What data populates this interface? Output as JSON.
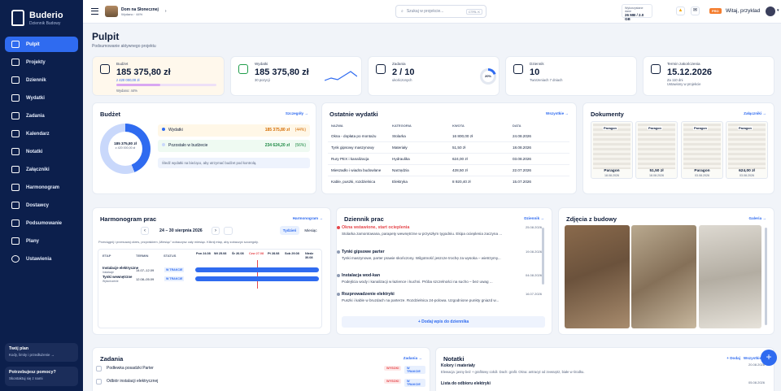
{
  "brand": {
    "title": "Buderio",
    "subtitle": "Dziennik Budowy"
  },
  "nav": [
    "Pulpit",
    "Projekty",
    "Dziennik",
    "Wydatki",
    "Zadania",
    "Kalendarz",
    "Notatki",
    "Załączniki",
    "Harmonogram",
    "Dostawcy",
    "Podsumowanie",
    "Plany",
    "Ustawienia"
  ],
  "plan": {
    "title": "Twój plan",
    "text": "Kody, limity i przedłużenie →"
  },
  "help": {
    "title": "Potrzebujesz pomocy?",
    "text": "Skontaktuj się z nami"
  },
  "topbar": {
    "project_name": "Dom na Słonecznej",
    "project_meta": "Wydano · 44%",
    "search_placeholder": "Szukaj w projekcie...",
    "kbd": "CTRL K",
    "storage_label": "Wykorzystane dane",
    "storage_value": "26 MB / 2.0 GB",
    "pro": "PRO",
    "welcome": "Witaj, przyklad"
  },
  "page": {
    "title": "Pulpit",
    "subtitle": "Podsumowanie aktywnego projektu"
  },
  "stats": [
    {
      "label": "Budżet",
      "value": "185 375,80 zł",
      "sub": "z 420 000,00 zł",
      "sub2": "Wydano: 44%"
    },
    {
      "label": "Wydatki",
      "value": "185 375,80 zł",
      "sub": "30 pozycji"
    },
    {
      "label": "Zadania",
      "value": "2 / 10",
      "sub": "ukończonych",
      "ring": "20%"
    },
    {
      "label": "Dziennik",
      "value": "10",
      "sub": "Tworzeniach 7 dniach"
    },
    {
      "label": "Termin zakończenia",
      "value": "15.12.2026",
      "sub": "Za 110 dni",
      "sub2": "Ustawiony w projekcie"
    }
  ],
  "budget": {
    "title": "Budżet",
    "link": "Szczegóły →",
    "donut_value": "185 375,80 zł",
    "donut_sub": "z 420 000,00 zł",
    "spent_label": "Wydatki",
    "spent_value": "185 375,80 zł",
    "spent_pct": "(44%)",
    "left_label": "Pozostało w budżecie",
    "left_value": "234 624,20 zł",
    "left_pct": "(56%)",
    "hint": "Śledź wydatki na bieżąco, aby utrzymać budżet pod kontrolą."
  },
  "expenses": {
    "title": "Ostatnie wydatki",
    "link": "Wszystkie →",
    "headers": [
      "NAZWA",
      "KATEGORIA",
      "KWOTA",
      "DATA"
    ],
    "rows": [
      [
        "Okna - dopłata po montażu",
        "Stolarka",
        "16 800,00 zł",
        "24.08.2026"
      ],
      [
        "Tynk gipsowy maszynowy",
        "Materiały",
        "51,50 zł",
        "18.08.2026"
      ],
      [
        "Rury PEX i kanalizacja",
        "Hydraulika",
        "624,00 zł",
        "03.08.2026"
      ],
      [
        "Mieszadło i wiadra budowlane",
        "Narzędzia",
        "428,50 zł",
        "22.07.2026"
      ],
      [
        "Kable, puszki, rozdzielnica",
        "Elektryka",
        "8 920,40 zł",
        "15.07.2026"
      ]
    ]
  },
  "documents": {
    "title": "Dokumenty",
    "link": "Załączniki →",
    "items": [
      {
        "stamp": "Paragon",
        "name": "Paragon",
        "date": "18.08.2026"
      },
      {
        "stamp": "Paragon",
        "name": "51,50 zł",
        "date": "18.08.2026"
      },
      {
        "stamp": "Paragon",
        "name": "Paragon",
        "date": "03.08.2026"
      },
      {
        "stamp": "Paragon",
        "name": "624,00 zł",
        "date": "03.08.2026"
      }
    ]
  },
  "schedule": {
    "title": "Harmonogram prac",
    "link": "Harmonogram →",
    "range": "24 – 30 sierpnia 2026",
    "view_week": "Tydzień",
    "view_month": "Miesiąc",
    "hint": "Przeciągnij i przesuwaj okres, przyciskiem „Miesiąc” zobaczysz cały miesiąc. Kliknij etap, aby zobaczyć szczegóły.",
    "headers": [
      "ETAP",
      "TERMIN",
      "STATUS"
    ],
    "days": [
      "Pon 24.08",
      "Wt 25.08",
      "Śr 26.08",
      "Czw 27.08",
      "Pt 28.08",
      "Sob 29.08",
      "Niedz 30.08"
    ],
    "rows": [
      {
        "name": "Instalacje elektryczne",
        "meta": "Instalacje",
        "term": "14.07–12.09",
        "status": "W TRAKCIE"
      },
      {
        "name": "Tynki wewnętrzne",
        "meta": "Wykończenie",
        "term": "12.08–05.09",
        "status": "W TRAKCIE"
      }
    ]
  },
  "diary": {
    "title": "Dziennik prac",
    "link": "Dziennik →",
    "add": "+ Dodaj wpis do dziennika",
    "items": [
      {
        "title": "Okna wstawione, start ocieplenia",
        "text": "Stolarka zamontowana, parapety wewnętrzne w przyszłym tygodniu. Ekipa ocieplenia zaczyna ...",
        "date": "25.08.2026"
      },
      {
        "title": "Tynki gipsowe parter",
        "text": "Tynki maszynowe, parter prawie skończony. Wilgotność jeszcze trochę za wysoka – wietrzymy...",
        "date": "19.08.2026"
      },
      {
        "title": "Instalacja wod-kan",
        "text": "Podejścia wody i kanalizacji w łazience i kuchni. Próba szczelności na sucho – bez uwag ...",
        "date": "04.08.2026"
      },
      {
        "title": "Rozprowadzenie elektryki",
        "text": "Puszki i kable w bruzdach na parterze. Rozdzielnica 24-polowa. Uzgodnione punkty gniazd w...",
        "date": "16.07.2026"
      }
    ]
  },
  "photos": {
    "title": "Zdjęcia z budowy",
    "link": "Galeria →"
  },
  "tasks": {
    "title": "Zadania",
    "link": "Zadania →",
    "items": [
      {
        "name": "Podłewka posadzki Parter",
        "priority": "WYSOKI",
        "status": "W TRAKCIE"
      },
      {
        "name": "Odbiór instalacji elektrycznej",
        "priority": "WYSOKI",
        "status": "W TRAKCIE"
      }
    ]
  },
  "notes": {
    "title": "Notatki",
    "add": "+ Dodaj",
    "link": "Wszystkie →",
    "items": [
      {
        "title": "Kolory i materiały",
        "text": "Elewacja: jasny beż + grafitowy cokół. Dach: grafit. Okna: antracyt od zewnątrz, białe w środku.",
        "date": "20.08.2026"
      },
      {
        "title": "Lista do odbioru elektryki",
        "text": "",
        "date": "05.08.2026"
      }
    ]
  },
  "colors": {
    "accent": "#2f6bf0",
    "sidebar": "#0c1f4c",
    "high": "#e5484d",
    "progress": "#d9a7f2"
  }
}
